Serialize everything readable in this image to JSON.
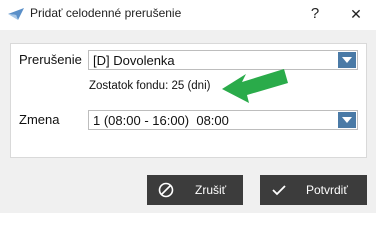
{
  "window": {
    "title": "Pridať celodenné prerušenie",
    "help_label": "?",
    "close_label": "✕"
  },
  "form": {
    "interruption": {
      "label": "Prerušenie",
      "value": "[D] Dovolenka"
    },
    "fund_balance": {
      "text": "Zostatok fondu:  25 (dni)"
    },
    "shift": {
      "label": "Zmena",
      "value": "1 (08:00 - 16:00)  08:00"
    }
  },
  "buttons": {
    "cancel_label": "Zrušiť",
    "confirm_label": "Potvrdiť"
  },
  "colors": {
    "accent": "#4a7aa6",
    "button_bg": "#3c3c3c",
    "highlight_arrow": "#2aab4a"
  },
  "icons": {
    "app": "paper-plane-icon",
    "cancel": "cancel-circle-icon",
    "confirm": "checkmark-icon"
  }
}
